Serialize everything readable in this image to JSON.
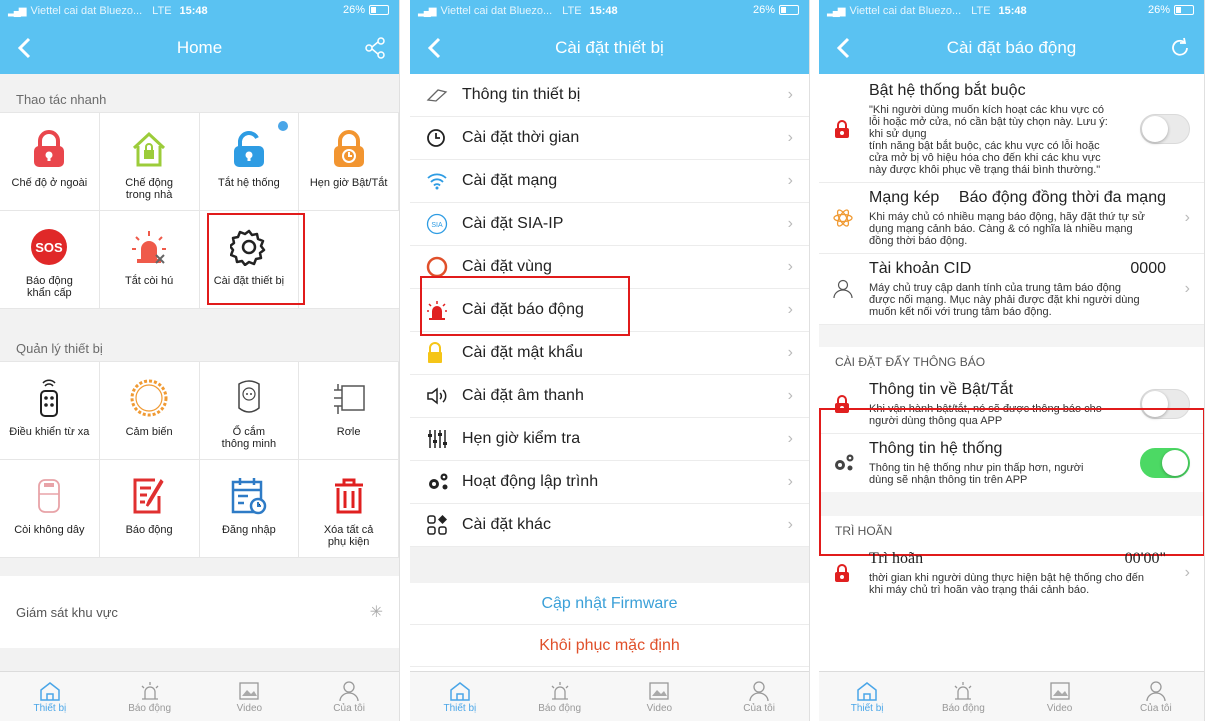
{
  "status": {
    "signal": "▂▄▆",
    "carrier": "Viettel cai dat Bluezo...",
    "network": "LTE",
    "time": "15:48",
    "battery": "26%"
  },
  "panel1": {
    "title": "Home",
    "quick_title": "Thao tác nhanh",
    "quick_items": [
      {
        "label": "Chế độ ở ngoài",
        "icon": "lock-red-icon"
      },
      {
        "label": "Chế động\ntrong nhà",
        "icon": "home-lock-icon"
      },
      {
        "label": "Tắt hệ thống",
        "icon": "unlock-blue-icon"
      },
      {
        "label": "Hẹn giờ Bật/Tắt",
        "icon": "timer-lock-icon"
      },
      {
        "label": "Báo động\nkhẩn cấp",
        "icon": "sos-icon",
        "sos": "SOS"
      },
      {
        "label": "Tắt còi hú",
        "icon": "siren-off-icon"
      },
      {
        "label": "Cài đặt thiết bị",
        "icon": "gear-icon"
      }
    ],
    "device_title": "Quản lý thiết bị",
    "device_items": [
      {
        "label": "Điều khiển từ xa",
        "icon": "remote-icon"
      },
      {
        "label": "Cảm biến",
        "icon": "sensor-ring-icon"
      },
      {
        "label": "Ổ cắm\nthông minh",
        "icon": "smart-plug-icon"
      },
      {
        "label": "Rơle",
        "icon": "relay-icon"
      },
      {
        "label": "Còi không dây",
        "icon": "wireless-siren-icon"
      },
      {
        "label": "Báo động",
        "icon": "alarm-log-icon"
      },
      {
        "label": "Đăng nhập",
        "icon": "login-log-icon"
      },
      {
        "label": "Xóa tất cả\nphụ kiện",
        "icon": "trash-icon"
      }
    ],
    "monitor_label": "Giám sát khu vực"
  },
  "tabs": [
    {
      "label": "Thiết bị",
      "icon": "home-tab-icon"
    },
    {
      "label": "Báo động",
      "icon": "alarm-tab-icon"
    },
    {
      "label": "Video",
      "icon": "video-tab-icon"
    },
    {
      "label": "Của tôi",
      "icon": "profile-tab-icon"
    }
  ],
  "panel2": {
    "title": "Cài đặt thiết bị",
    "items": [
      {
        "label": "Thông tin thiết bị",
        "icon": "device-info-icon"
      },
      {
        "label": "Cài đặt thời gian",
        "icon": "clock-icon"
      },
      {
        "label": "Cài đặt mạng",
        "icon": "wifi-icon"
      },
      {
        "label": "Cài đặt SIA-IP",
        "icon": "sia-icon",
        "badge": "SIA"
      },
      {
        "label": "Cài đặt vùng",
        "icon": "zone-ring-icon"
      },
      {
        "label": "Cài đặt báo động",
        "icon": "alarm-siren-icon"
      },
      {
        "label": "Cài đặt mật khẩu",
        "icon": "password-lock-icon"
      },
      {
        "label": "Cài đặt âm thanh",
        "icon": "speaker-icon"
      },
      {
        "label": "Hẹn giờ kiểm tra",
        "icon": "sliders-icon"
      },
      {
        "label": "Hoạt động lập trình",
        "icon": "gears-icon"
      },
      {
        "label": "Cài đặt khác",
        "icon": "more-settings-icon"
      }
    ],
    "firmware": "Cập nhật Firmware",
    "reset": "Khôi phục mặc định"
  },
  "panel3": {
    "title": "Cài đặt báo động",
    "force_arm": {
      "title": "Bật hệ thống bắt buộc",
      "desc": "\"Khi người dùng muốn kích hoạt các khu vực có\nlỗi hoặc mở cửa, nó cần bật tùy chọn này. Lưu ý:\nkhi sử dụng\ntính năng bật bắt buộc, các khu vực có lỗi hoặc\ncửa mở bị vô hiệu hóa cho đến khi các khu vực\nnày được khôi phục về trạng thái bình thường.\""
    },
    "dual_net": {
      "title": "Mạng kép",
      "value": "Báo động đồng thời đa mạng",
      "desc": "Khi máy chủ có nhiều mạng báo động, hãy đặt thứ tự sử\ndụng mạng cảnh báo. Càng & có nghĩa là nhiều mạng\nđồng thời báo động."
    },
    "cid": {
      "title": "Tài khoản CID",
      "value": "0000",
      "desc": "Máy chủ truy cập danh tính của trung tâm báo động\nđược nối mạng. Mục này phải được đặt khi người dùng\nmuốn kết nối với trung tâm báo động."
    },
    "push_header": "CÀI ĐẶT ĐẨY THÔNG BÁO",
    "onoff": {
      "title": "Thông tin về Bật/Tắt",
      "desc": "Khi vận hành bật/tắt, nó sẽ được thông báo cho\nngười dùng thông qua APP"
    },
    "sysinfo": {
      "title": "Thông tin hệ thống",
      "desc": "Thông tin hệ thống như pin thấp hơn, người\ndùng sẽ nhận thông tin trên APP"
    },
    "delay_header": "TRÌ HOÃN",
    "delay": {
      "title": "Trì hoãn",
      "value": "00'00\"",
      "desc": "thời gian khi người dùng thực hiện bật hệ thống cho đến\nkhi máy chủ trì hoãn vào trạng thái cảnh báo."
    }
  },
  "colors": {
    "accent": "#5ac2f2",
    "highlight": "#e11b1b",
    "danger_text": "#e0502b",
    "link": "#3ba0d8",
    "toggle_on": "#4cd964"
  }
}
